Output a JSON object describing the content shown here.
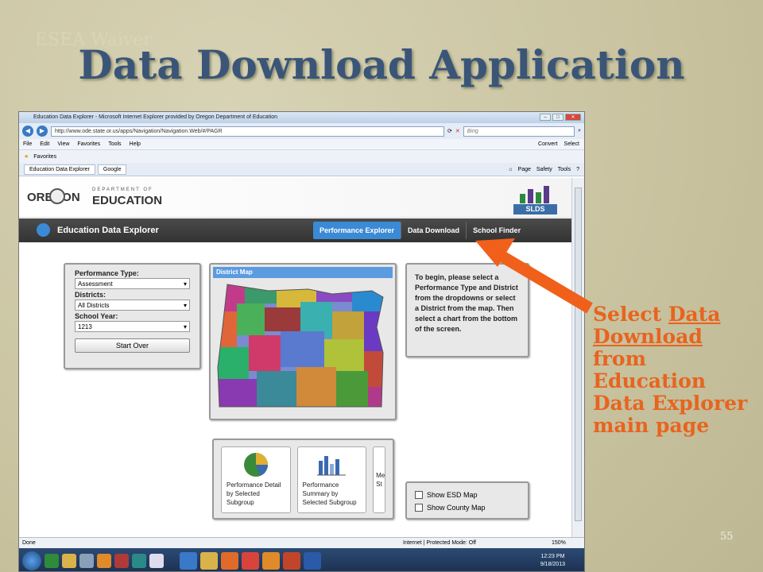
{
  "slide": {
    "subtitle": "ESEA Waiver",
    "title": "Data Download Application",
    "callout_prefix": "Select ",
    "callout_link": "Data Download",
    "callout_suffix": "from Education Data Explorer main page",
    "page_number": "55",
    "accent_color": "#e8641e"
  },
  "browser": {
    "window_title": "Education Data Explorer - Microsoft Internet Explorer provided by Oregon Department of Education",
    "url": "http://www.ode.state.or.us/apps/Navigation/Navigation.Web/#/PAGR",
    "search_placeholder": "Bing",
    "menu": [
      "File",
      "Edit",
      "View",
      "Favorites",
      "Tools",
      "Help"
    ],
    "menu_right": [
      "Convert",
      "Select"
    ],
    "favorites_label": "Favorites",
    "tabs": [
      "Education Data Explorer",
      "Google"
    ],
    "toolbar_right": [
      "Page",
      "Safety",
      "Tools"
    ],
    "status_left": "Done",
    "status_mode": "Internet | Protected Mode: Off",
    "zoom": "150%",
    "clock_time": "12:23 PM",
    "clock_date": "9/18/2013"
  },
  "app": {
    "logo_state": "OREGON",
    "logo_dept": "DEPARTMENT OF",
    "logo_edu": "EDUCATION",
    "slds_label": "SLDS",
    "name": "Education Data Explorer",
    "nav": [
      "Performance Explorer",
      "Data Download",
      "School Finder"
    ],
    "filters": {
      "performance_type_label": "Performance Type:",
      "performance_type_value": "Assessment",
      "districts_label": "Districts:",
      "districts_value": "All Districts",
      "school_year_label": "School Year:",
      "school_year_value": "1213",
      "start_over": "Start Over"
    },
    "map_title": "District Map",
    "info_text": "To begin, please select a Performance Type and District from the dropdowns or select a District from the map. Then select a chart from the bottom of the screen.",
    "charts": [
      "Performance Detail by Selected Subgroup",
      "Performance Summary by Selected Subgroup",
      "Me St"
    ],
    "map_options": [
      "Show ESD Map",
      "Show County Map"
    ]
  }
}
